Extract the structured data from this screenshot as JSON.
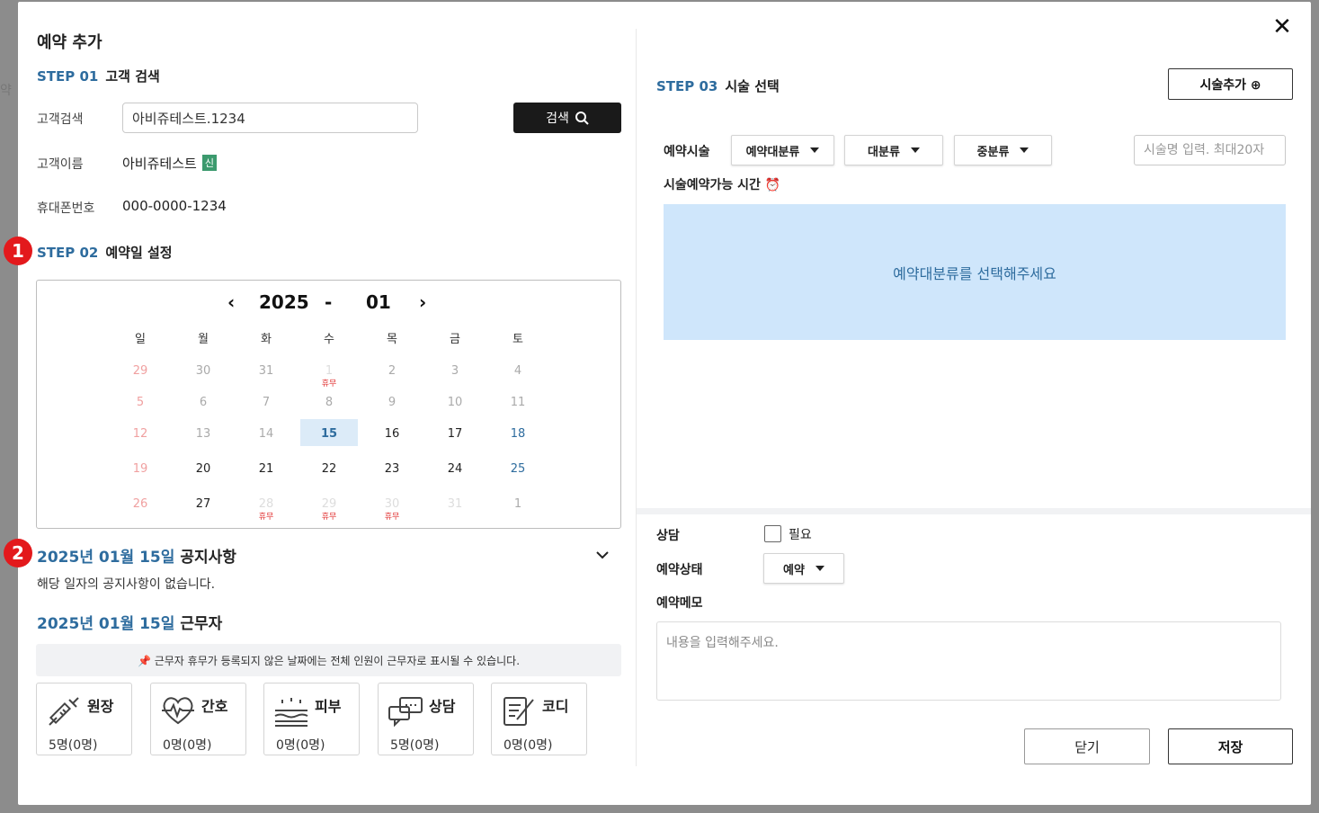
{
  "modal": {
    "title": "예약 추가",
    "close_icon": "close-icon"
  },
  "step1": {
    "no": "STEP 01",
    "label": "고객 검색",
    "search_label": "고객검색",
    "search_value": "아비쥬테스트.1234",
    "search_button": "검색",
    "name_label": "고객이름",
    "name_value": "아비쥬테스트",
    "new_badge": "신",
    "phone_label": "휴대폰번호",
    "phone_value": "000-0000-1234"
  },
  "markers": {
    "m1": "1",
    "m2": "2"
  },
  "step2": {
    "no": "STEP 02",
    "label": "예약일 설정",
    "calendar": {
      "year": "2025",
      "separator": "-",
      "month": "01",
      "weekdays": [
        "일",
        "월",
        "화",
        "수",
        "목",
        "금",
        "토"
      ],
      "weeks": [
        [
          "29",
          "30",
          "31",
          "1",
          "2",
          "3",
          "4"
        ],
        [
          "5",
          "6",
          "7",
          "8",
          "9",
          "10",
          "11"
        ],
        [
          "12",
          "13",
          "14",
          "15",
          "16",
          "17",
          "18"
        ],
        [
          "19",
          "20",
          "21",
          "22",
          "23",
          "24",
          "25"
        ],
        [
          "26",
          "27",
          "28",
          "29",
          "30",
          "31",
          "1"
        ]
      ],
      "holiday_label": "휴무",
      "selected": "15"
    }
  },
  "notice": {
    "date": "2025년 01월 15일",
    "label": "공지사항",
    "text": "해당 일자의 공지사항이 없습니다."
  },
  "staff": {
    "date": "2025년 01월 15일",
    "label": "근무자",
    "info": "📌 근무자 휴무가 등록되지 않은 날짜에는 전체 인원이 근무자로 표시될 수 있습니다.",
    "cards": [
      {
        "name": "원장",
        "count": "5명(0명)",
        "icon": "syringe-icon"
      },
      {
        "name": "간호",
        "count": "0명(0명)",
        "icon": "heart-pulse-icon"
      },
      {
        "name": "피부",
        "count": "0명(0명)",
        "icon": "skin-icon"
      },
      {
        "name": "상담",
        "count": "5명(0명)",
        "icon": "chat-icon"
      },
      {
        "name": "코디",
        "count": "0명(0명)",
        "icon": "edit-note-icon"
      }
    ]
  },
  "step3": {
    "no": "STEP 03",
    "label": "시술 선택",
    "add_button": "시술추가 ⊕",
    "treat_label": "예약시술",
    "dropdowns": [
      "예약대분류",
      "대분류",
      "중분류"
    ],
    "treat_placeholder": "시술명 입력. 최대20자",
    "avail_label": "시술예약가능 시간 ⏰",
    "avail_message": "예약대분류를 선택해주세요"
  },
  "form": {
    "consult_label": "상담",
    "consult_check": "필요",
    "status_label": "예약상태",
    "status_value": "예약",
    "memo_label": "예약메모",
    "memo_placeholder": "내용을 입력해주세요."
  },
  "footer": {
    "close": "닫기",
    "save": "저장"
  },
  "colors": {
    "accent": "#2e6c9e",
    "holiday": "#e03030",
    "avail_bg": "#cfe6fb",
    "marker": "#e3191c"
  }
}
